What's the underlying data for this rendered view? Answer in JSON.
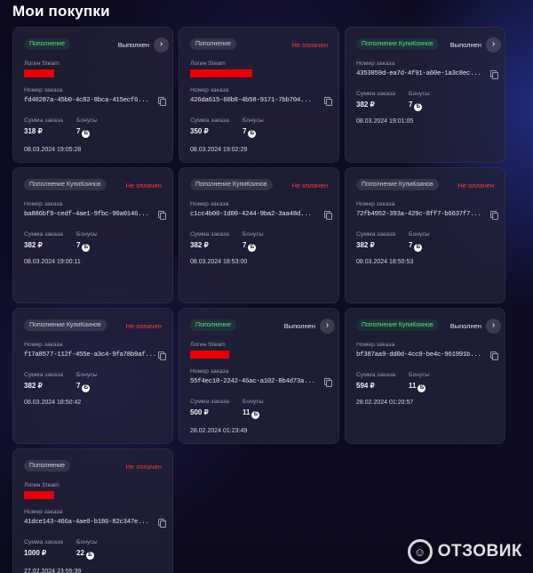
{
  "page": {
    "title": "Мои покупки"
  },
  "labels": {
    "steam_login": "Логин Steam",
    "order_number": "Номер заказа",
    "order_sum": "Сумма заказа",
    "bonuses": "Бонусы",
    "bonus_coin": "Б"
  },
  "cards": [
    {
      "badge": "Пополнение",
      "badge_color": "green",
      "status": "Выполнен",
      "status_type": "done",
      "has_arrow": true,
      "has_login": true,
      "order": "fd40287a-45b0-4c82-8bca-415ecf6...",
      "sum": "318 ₽",
      "bonus": "7",
      "date": "08.03.2024 19:05:28"
    },
    {
      "badge": "Пополнение",
      "badge_color": "gray",
      "status": "Не оплачен",
      "status_type": "unpaid",
      "has_arrow": false,
      "has_login": true,
      "order": "426da615-60b8-4b58-9171-7bb704...",
      "sum": "350 ₽",
      "bonus": "7",
      "date": "08.03.2024 19:02:29"
    },
    {
      "badge": "Пополнение КупиКоинов",
      "badge_color": "green",
      "status": "Выполнен",
      "status_type": "done",
      "has_arrow": true,
      "has_login": false,
      "order": "4353859d-ea7d-4f91-a60e-1a3c8ec...",
      "sum": "382 ₽",
      "bonus": "7",
      "date": "08.03.2024 19:01:05"
    },
    {
      "badge": "Пополнение КупиКоинов",
      "badge_color": "gray",
      "status": "Не оплачен",
      "status_type": "unpaid",
      "has_arrow": false,
      "has_login": false,
      "order": "ba886bf9-cedf-4ae1-9fbc-90a0146...",
      "sum": "382 ₽",
      "bonus": "7",
      "date": "08.03.2024 19:00:11"
    },
    {
      "badge": "Пополнение КупиКоинов",
      "badge_color": "gray",
      "status": "Не оплачен",
      "status_type": "unpaid",
      "has_arrow": false,
      "has_login": false,
      "order": "c1cc4b00-1d00-4244-9ba2-3aa48d...",
      "sum": "382 ₽",
      "bonus": "7",
      "date": "08.03.2024 18:53:00"
    },
    {
      "badge": "Пополнение КупиКоинов",
      "badge_color": "gray",
      "status": "Не оплачен",
      "status_type": "unpaid",
      "has_arrow": false,
      "has_login": false,
      "order": "72fb4952-393a-429c-8ff7-b6637f7...",
      "sum": "382 ₽",
      "bonus": "7",
      "date": "08.03.2024 18:50:53"
    },
    {
      "badge": "Пополнение КупиКоинов",
      "badge_color": "gray",
      "status": "Не оплачен",
      "status_type": "unpaid",
      "has_arrow": false,
      "has_login": false,
      "order": "f17a8577-112f-455e-a3c4-9fa78b9af...",
      "sum": "382 ₽",
      "bonus": "7",
      "date": "08.03.2024 18:50:42"
    },
    {
      "badge": "Пополнение",
      "badge_color": "green",
      "status": "Выполнен",
      "status_type": "done",
      "has_arrow": true,
      "has_login": true,
      "order": "55f4ec10-2242-46ac-a102-8b4d73a...",
      "sum": "500 ₽",
      "bonus": "11",
      "date": "28.02.2024 01:23:49"
    },
    {
      "badge": "Пополнение КупиКоинов",
      "badge_color": "green",
      "status": "Выполнен",
      "status_type": "done",
      "has_arrow": true,
      "has_login": false,
      "order": "bf387aa9-dd0d-4cc0-be4c-961991b...",
      "sum": "594 ₽",
      "bonus": "11",
      "date": "28.02.2024 01:20:57"
    },
    {
      "badge": "Пополнение",
      "badge_color": "gray",
      "status": "Не оплачен",
      "status_type": "unpaid",
      "has_arrow": false,
      "has_login": true,
      "order": "41dce143-466a-4ae0-b186-82c347e...",
      "sum": "1000 ₽",
      "bonus": "22",
      "date": "27.02.2024 23:55:39"
    }
  ],
  "watermark": {
    "text": "ОТЗОВИК"
  }
}
